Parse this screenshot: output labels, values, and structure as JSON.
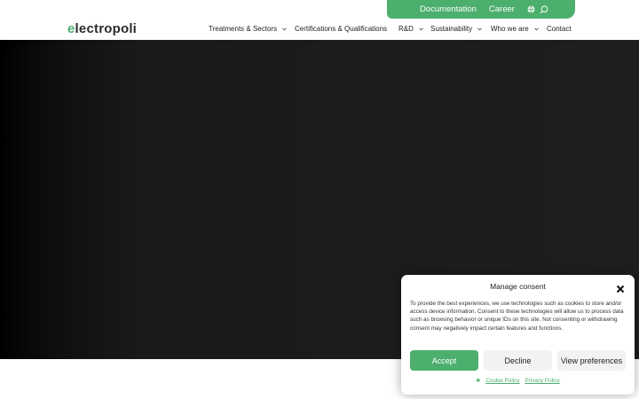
{
  "topbar": {
    "documentation": "Documentation",
    "career": "Career"
  },
  "brand": {
    "logo_prefix": "e",
    "logo_rest": "lectropoli",
    "accent": "#4caf6e"
  },
  "nav": {
    "items": [
      {
        "label": "Treatments & Sectors",
        "has_dropdown": true
      },
      {
        "label": "Certifications & Qualifications",
        "has_dropdown": false
      },
      {
        "label": "R&D",
        "has_dropdown": true
      },
      {
        "label": "Sustainability",
        "has_dropdown": true
      },
      {
        "label": "Who we are",
        "has_dropdown": true
      },
      {
        "label": "Contact",
        "has_dropdown": false
      }
    ]
  },
  "consent": {
    "title": "Manage consent",
    "body": "To provide the best experiences, we use technologies such as cookies to store and/or access device information. Consent to these technologies will allow us to process data such as browsing behavior or unique IDs on this site. Not consenting or withdrawing consent may negatively impact certain features and functions.",
    "accept": "Accept",
    "decline": "Decline",
    "preferences": "View preferences",
    "cookie_policy": "Cookie Policy",
    "privacy_policy": "Privacy Policy"
  },
  "icons": [
    "globe-icon",
    "search-icon",
    "chevron-down-icon",
    "close-icon"
  ]
}
